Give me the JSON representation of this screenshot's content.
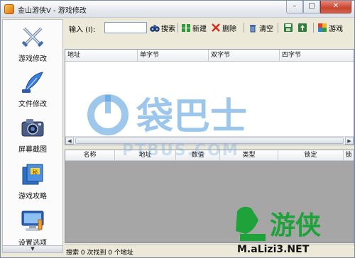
{
  "window": {
    "title": "金山游侠V - 游戏修改",
    "controls": {
      "minimize": "–",
      "maximize": "□",
      "close": "✕"
    }
  },
  "sidebar": {
    "items": [
      {
        "label": "游戏修改",
        "icon": "crossed-swords-icon"
      },
      {
        "label": "文件修改",
        "icon": "blue-feather-pen-icon"
      },
      {
        "label": "屏幕截图",
        "icon": "camera-icon"
      },
      {
        "label": "游戏攻略",
        "icon": "books-icon"
      },
      {
        "label": "设置选项",
        "icon": "monitor-settings-icon"
      }
    ],
    "scroll_arrow": "▼"
  },
  "toolbar": {
    "input_label": "输入 (I):",
    "input_value": "",
    "buttons": [
      {
        "label": "搜索",
        "icon": "binoculars-icon"
      },
      {
        "label": "新建",
        "icon": "new-icon"
      },
      {
        "label": "删除",
        "icon": "delete-x-icon"
      },
      {
        "label": "清空",
        "icon": "trash-icon"
      },
      {
        "label": "",
        "icon": "save-icon"
      },
      {
        "label": "",
        "icon": "load-icon"
      },
      {
        "label": "游戏",
        "icon": "game-icon"
      }
    ]
  },
  "upper_list": {
    "columns": [
      "地址",
      "单字节",
      "双字节",
      "四字节"
    ]
  },
  "lower_list": {
    "columns": [
      "名称",
      "地址",
      "数值",
      "类型",
      "锁定",
      "锁"
    ]
  },
  "status": {
    "text": "搜索 0 次找到 0 个地址"
  },
  "watermarks": {
    "center": "袋巴士",
    "center_sub": "PTBUS.COM",
    "corner": "游侠",
    "corner_site": "M.aLizi3.NET"
  },
  "colors": {
    "watermark_blue": "#2f86d6",
    "logo_green": "#1fa23a",
    "close_red": "#c6442f"
  }
}
